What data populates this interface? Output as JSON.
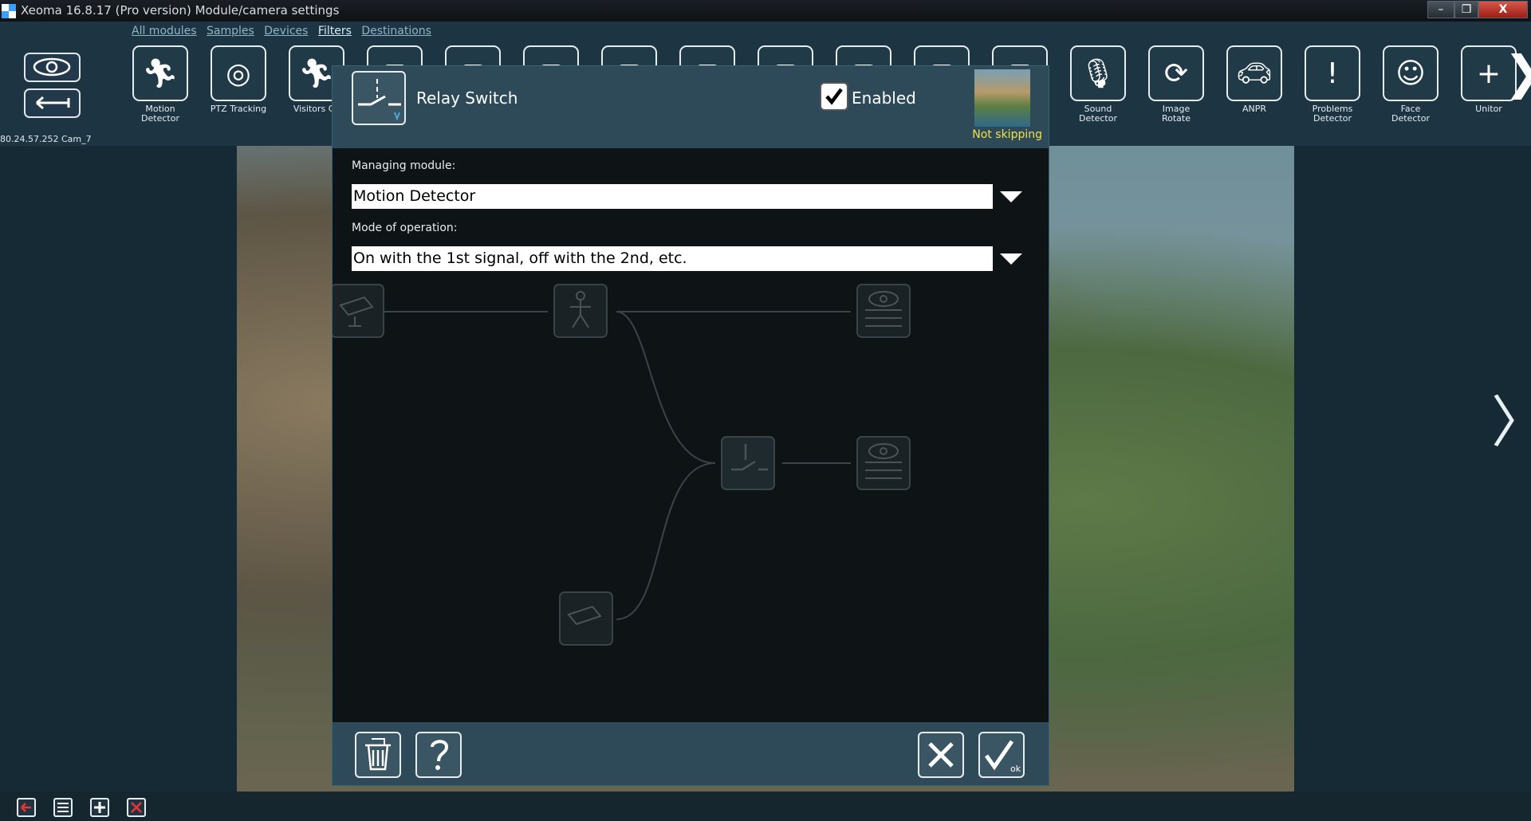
{
  "window": {
    "title": "Xeoma 16.8.17 (Pro version) Module/camera settings",
    "min": "–",
    "max": "❐",
    "close": "X"
  },
  "tabs": [
    "All modules",
    "Samples",
    "Devices",
    "Filters",
    "Destinations"
  ],
  "active_tab": "Filters",
  "camera_label": "80.24.57.252 Cam_7",
  "modules": [
    {
      "label": "Motion Detector",
      "icon": "motion-detector-icon"
    },
    {
      "label": "PTZ Tracking",
      "icon": "ptz-tracking-icon"
    },
    {
      "label": "Visitors Co",
      "icon": "visitors-counter-icon"
    },
    {
      "label": "",
      "icon": "module-icon"
    },
    {
      "label": "",
      "icon": "module-icon"
    },
    {
      "label": "",
      "icon": "module-icon"
    },
    {
      "label": "",
      "icon": "module-icon"
    },
    {
      "label": "",
      "icon": "module-icon"
    },
    {
      "label": "",
      "icon": "module-icon"
    },
    {
      "label": "",
      "icon": "module-icon"
    },
    {
      "label": "",
      "icon": "module-icon"
    },
    {
      "label": "",
      "icon": "module-icon"
    },
    {
      "label": "Sound Detector",
      "icon": "sound-detector-icon"
    },
    {
      "label": "Image Rotate",
      "icon": "image-rotate-icon"
    },
    {
      "label": "ANPR",
      "icon": "car-icon"
    },
    {
      "label": "Problems Detector",
      "icon": "exclamation-icon"
    },
    {
      "label": "Face Detector",
      "icon": "face-icon"
    },
    {
      "label": "Unitor",
      "icon": "unitor-icon"
    }
  ],
  "dialog": {
    "title": "Relay Switch",
    "enabled_label": "Enabled",
    "enabled": true,
    "skip_status": "Not skipping",
    "managing_label": "Managing module:",
    "managing_value": "Motion Detector",
    "mode_label": "Mode of operation:",
    "mode_value": "On with the 1st signal, off with the 2nd, etc.",
    "ok_sub": "ok"
  },
  "colors": {
    "accent": "#2e4a58",
    "skip_status": "#f2e14a",
    "close_button": "#c0392b"
  }
}
